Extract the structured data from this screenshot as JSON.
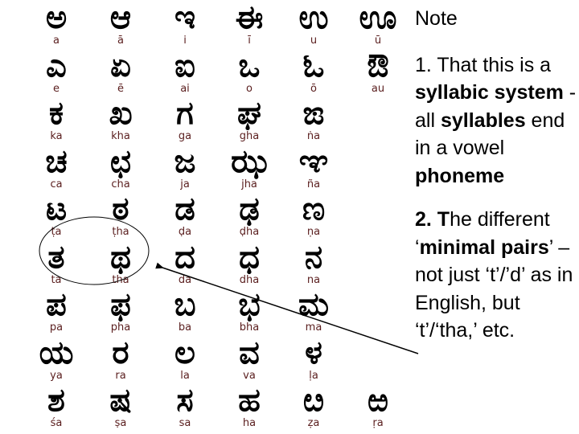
{
  "alphabet": {
    "rows": [
      [
        {
          "glyph": "ಅ",
          "roman": "a"
        },
        {
          "glyph": "ಆ",
          "roman": "ā"
        },
        {
          "glyph": "ಇ",
          "roman": "i"
        },
        {
          "glyph": "ಈ",
          "roman": "ī"
        },
        {
          "glyph": "ಉ",
          "roman": "u"
        },
        {
          "glyph": "ಊ",
          "roman": "ū"
        }
      ],
      [
        {
          "glyph": "ಎ",
          "roman": "e"
        },
        {
          "glyph": "ಏ",
          "roman": "ē"
        },
        {
          "glyph": "ಐ",
          "roman": "ai"
        },
        {
          "glyph": "ಒ",
          "roman": "o"
        },
        {
          "glyph": "ಓ",
          "roman": "ō"
        },
        {
          "glyph": "ಔ",
          "roman": "au"
        }
      ],
      [
        {
          "glyph": "ಕ",
          "roman": "ka"
        },
        {
          "glyph": "ಖ",
          "roman": "kha"
        },
        {
          "glyph": "ಗ",
          "roman": "ga"
        },
        {
          "glyph": "ಘ",
          "roman": "gha"
        },
        {
          "glyph": "ಙ",
          "roman": "ṅa"
        }
      ],
      [
        {
          "glyph": "ಚ",
          "roman": "ca"
        },
        {
          "glyph": "ಛ",
          "roman": "cha"
        },
        {
          "glyph": "ಜ",
          "roman": "ja"
        },
        {
          "glyph": "ಝ",
          "roman": "jha"
        },
        {
          "glyph": "ಞ",
          "roman": "ña"
        }
      ],
      [
        {
          "glyph": "ಟ",
          "roman": "ṭa"
        },
        {
          "glyph": "ಠ",
          "roman": "ṭha"
        },
        {
          "glyph": "ಡ",
          "roman": "ḍa"
        },
        {
          "glyph": "ಢ",
          "roman": "ḍha"
        },
        {
          "glyph": "ಣ",
          "roman": "ṇa"
        }
      ],
      [
        {
          "glyph": "ತ",
          "roman": "ta"
        },
        {
          "glyph": "ಥ",
          "roman": "tha"
        },
        {
          "glyph": "ದ",
          "roman": "da"
        },
        {
          "glyph": "ಧ",
          "roman": "dha"
        },
        {
          "glyph": "ನ",
          "roman": "na"
        }
      ],
      [
        {
          "glyph": "ಪ",
          "roman": "pa"
        },
        {
          "glyph": "ಫ",
          "roman": "pha"
        },
        {
          "glyph": "ಬ",
          "roman": "ba"
        },
        {
          "glyph": "ಭ",
          "roman": "bha"
        },
        {
          "glyph": "ಮ",
          "roman": "ma"
        }
      ],
      [
        {
          "glyph": "ಯ",
          "roman": "ya"
        },
        {
          "glyph": "ರ",
          "roman": "ra"
        },
        {
          "glyph": "ಲ",
          "roman": "la"
        },
        {
          "glyph": "ವ",
          "roman": "va"
        },
        {
          "glyph": "ಳ",
          "roman": "ḷa"
        }
      ],
      [
        {
          "glyph": "ಶ",
          "roman": "śa"
        },
        {
          "glyph": "ಷ",
          "roman": "ṣa"
        },
        {
          "glyph": "ಸ",
          "roman": "sa"
        },
        {
          "glyph": "ಹ",
          "roman": "ha"
        },
        {
          "glyph": "ೞ",
          "roman": "ẓa"
        },
        {
          "glyph": "ಱ",
          "roman": "ṛa"
        }
      ]
    ],
    "highlight": {
      "row": 5,
      "cols": [
        0,
        1
      ],
      "label": "minimal pair ta / tha"
    }
  },
  "note": {
    "title": "Note",
    "point1": {
      "t1": "1. That this is a ",
      "b1": "syllabic system",
      "t2": " - all ",
      "b2": "syllables",
      "t3": " end in a vowel ",
      "b3": "phoneme"
    },
    "point2": {
      "b1": "2. T",
      "t1": "he different ‘",
      "b2": "minimal pairs",
      "t2": "’ – not just ‘t’/’d’ as in English, but ‘t’/‘tha,’ etc."
    }
  },
  "colors": {
    "glyph": "#000000",
    "transliteration": "#5a1e1e",
    "annotation": "#000000"
  }
}
